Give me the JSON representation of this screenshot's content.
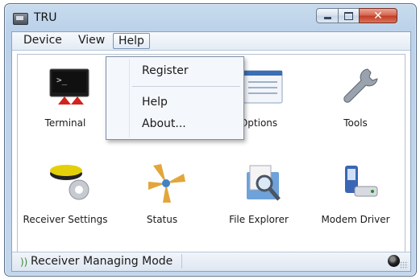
{
  "window": {
    "title": "TRU",
    "icons": {
      "app": "tru-app-icon",
      "minimize": "minimize-icon",
      "maximize": "maximize-icon",
      "close": "close-icon"
    }
  },
  "menubar": {
    "items": [
      {
        "label": "Device"
      },
      {
        "label": "View"
      },
      {
        "label": "Help"
      }
    ]
  },
  "help_menu": {
    "items": [
      {
        "label": "Register"
      },
      {
        "label": "Help"
      },
      {
        "label": "About..."
      }
    ]
  },
  "tiles": [
    {
      "label": "Terminal",
      "icon": "terminal-icon"
    },
    {
      "label": "",
      "icon": "device-icon"
    },
    {
      "label": "Options",
      "icon": "options-icon"
    },
    {
      "label": "Tools",
      "icon": "tools-icon"
    },
    {
      "label": "Receiver Settings",
      "icon": "receiver-settings-icon"
    },
    {
      "label": "Status",
      "icon": "status-icon"
    },
    {
      "label": "File Explorer",
      "icon": "file-explorer-icon"
    },
    {
      "label": "Modem Driver",
      "icon": "modem-driver-icon"
    }
  ],
  "statusbar": {
    "mode_text": "Receiver Managing Mode",
    "icons": {
      "mode": "signal-icon",
      "connection": "globe-icon"
    }
  },
  "colors": {
    "title_bg": "#c2d6ec",
    "close_button": "#c23a22",
    "menu_highlight": "#dfe9f5",
    "status_icon": "#3c8a2e"
  }
}
